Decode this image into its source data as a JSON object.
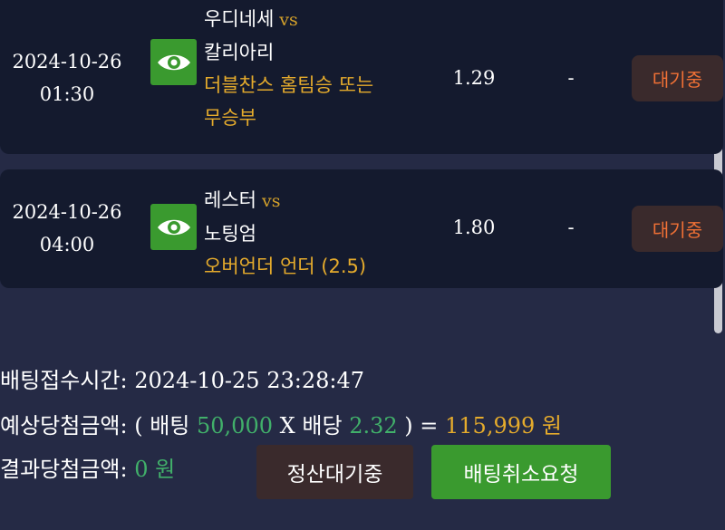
{
  "bets": [
    {
      "date": "2024-10-26",
      "time": "01:30",
      "home_team": "우디네세",
      "vs": "vs",
      "away_team": "칼리아리",
      "pick_line1": "더블찬스 홈팀승 또는",
      "pick_line2": "무승부",
      "odds": "1.29",
      "result": "-",
      "status": "대기중",
      "icon": "eye-icon"
    },
    {
      "date": "2024-10-26",
      "time": "04:00",
      "home_team": "레스터",
      "vs": "vs",
      "away_team": "노팅엄",
      "pick_line1": "오버언더 언더 (2.5)",
      "pick_line2": "",
      "odds": "1.80",
      "result": "-",
      "status": "대기중",
      "icon": "eye-icon"
    }
  ],
  "summary": {
    "bet_time_label": "배팅접수시간",
    "bet_time_value": "2024-10-25 23:28:47",
    "expected_label": "예상당첨금액",
    "expected_open": "( ",
    "bet_word": "배팅",
    "stake": "50,000",
    "times_sign": "X",
    "odds_word": "배당",
    "total_odds": "2.32",
    "expected_close": ") =",
    "expected_amount": "115,999",
    "won": "원",
    "result_label": "결과당첨금액",
    "result_amount": "0",
    "result_won": "원"
  },
  "buttons": {
    "settle_label": "정산대기중",
    "cancel_label": "배팅취소요청"
  },
  "colors": {
    "background": "#252a45",
    "card": "#141a2e",
    "accent_green": "#3a9a2f",
    "pick_gold": "#e5ab2c",
    "status_orange": "#ef7035",
    "amount_green": "#41b06a"
  }
}
